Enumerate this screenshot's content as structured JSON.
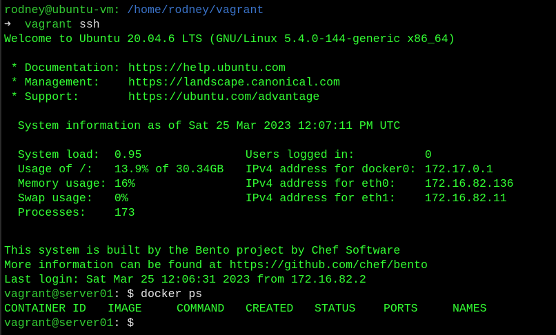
{
  "prompt_header": {
    "user_host": "rodney@ubuntu-vm:",
    "path": "/home/rodney/vagrant"
  },
  "command1": {
    "arrow": "➜",
    "program": "vagrant",
    "args": "ssh"
  },
  "welcome": "Welcome to Ubuntu 20.04.6 LTS (GNU/Linux 5.4.0-144-generic x86_64)",
  "motd_links": [
    {
      "label": " * Documentation:",
      "url": "https://help.ubuntu.com"
    },
    {
      "label": " * Management:",
      "url": "https://landscape.canonical.com"
    },
    {
      "label": " * Support:",
      "url": "https://ubuntu.com/advantage"
    }
  ],
  "sysinfo_title": "  System information as of Sat 25 Mar 2023 12:07:11 PM UTC",
  "sysinfo": {
    "left": [
      {
        "label": "System load:",
        "value": "0.95"
      },
      {
        "label": "Usage of /:",
        "value": "13.9% of 30.34GB"
      },
      {
        "label": "Memory usage:",
        "value": "16%"
      },
      {
        "label": "Swap usage:",
        "value": "0%"
      },
      {
        "label": "Processes:",
        "value": "173"
      }
    ],
    "right": [
      {
        "label": "Users logged in:",
        "value": "0"
      },
      {
        "label": "IPv4 address for docker0:",
        "value": "172.17.0.1"
      },
      {
        "label": "IPv4 address for eth0:",
        "value": "172.16.82.136"
      },
      {
        "label": "IPv4 address for eth1:",
        "value": "172.16.82.11"
      }
    ]
  },
  "bento_line": "This system is built by the Bento project by Chef Software",
  "more_info_line": "More information can be found at https://github.com/chef/bento",
  "last_login": "Last login: Sat Mar 25 12:06:31 2023 from 172.16.82.2",
  "prompt2": {
    "host": "vagrant@server01",
    "rest": ": $ docker ps"
  },
  "docker_headers": [
    "CONTAINER ID",
    "IMAGE",
    "COMMAND",
    "CREATED",
    "STATUS",
    "PORTS",
    "NAMES"
  ],
  "prompt3": {
    "host": "vagrant@server01",
    "rest": ": $"
  }
}
